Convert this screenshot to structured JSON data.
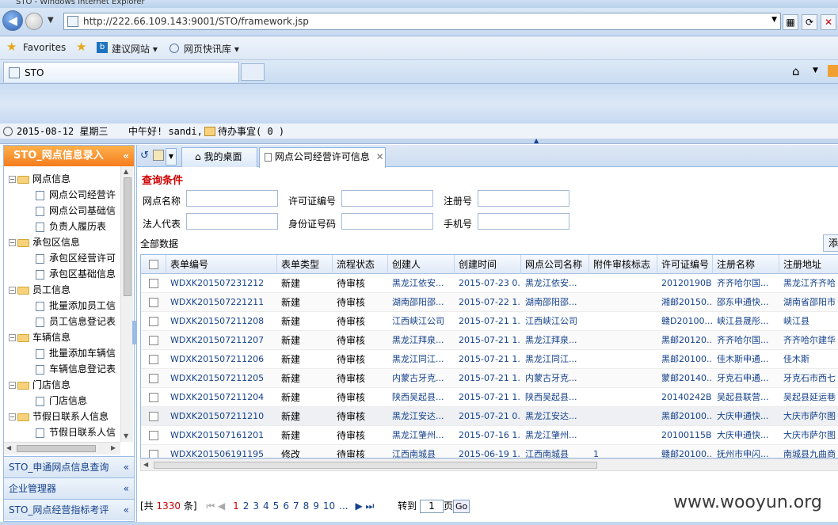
{
  "browser": {
    "window_title": "STO - Windows Internet Explorer",
    "url": "http://222.66.109.143:9001/STO/framework.jsp",
    "favorites_label": "Favorites",
    "fav_items": [
      "建议网站 ▾",
      "网页快讯库 ▾"
    ],
    "tab_title": "STO",
    "icons": [
      "back-arrow",
      "forward-arrow",
      "page",
      "compat-view",
      "refresh",
      "close",
      "star",
      "home"
    ]
  },
  "status": {
    "date": "2015-08-12 星期三",
    "greeting": "中午好! sandi,",
    "todo": "待办事宜( 0 )"
  },
  "left_panel": {
    "header": "STO_网点信息录入",
    "tree": [
      {
        "label": "网点信息",
        "level": 0
      },
      {
        "label": "网点公司经营许",
        "level": 1
      },
      {
        "label": "网点公司基础信",
        "level": 1
      },
      {
        "label": "负责人履历表",
        "level": 1
      },
      {
        "label": "承包区信息",
        "level": 0
      },
      {
        "label": "承包区经营许可",
        "level": 1
      },
      {
        "label": "承包区基础信息",
        "level": 1
      },
      {
        "label": "员工信息",
        "level": 0
      },
      {
        "label": "批量添加员工信",
        "level": 1
      },
      {
        "label": "员工信息登记表",
        "level": 1
      },
      {
        "label": "车辆信息",
        "level": 0
      },
      {
        "label": "批量添加车辆信",
        "level": 1
      },
      {
        "label": "车辆信息登记表",
        "level": 1
      },
      {
        "label": "门店信息",
        "level": 0
      },
      {
        "label": "门店信息",
        "level": 1
      },
      {
        "label": "节假日联系人信息",
        "level": 0
      },
      {
        "label": "节假日联系人信",
        "level": 1
      }
    ],
    "accordions": [
      "STO_申通网点信息查询",
      "企业管理器",
      "STO_网点经营指标考评"
    ]
  },
  "main": {
    "tabs": [
      "我的桌面",
      "网点公司经营许可信息"
    ],
    "query_title": "查询条件",
    "fields": {
      "name": "网点名称",
      "license_no": "许可证编号",
      "reg_no": "注册号",
      "legal_rep": "法人代表",
      "id_no": "身份证号码",
      "phone": "手机号"
    },
    "all_data": "全部数据",
    "add_label": "添",
    "columns": [
      "表单编号",
      "表单类型",
      "流程状态",
      "创建人",
      "创建时间",
      "网点公司名称",
      "附件审核标志",
      "许可证编号",
      "注册名称",
      "注册地址"
    ],
    "rows": [
      [
        "WDXK201507231212",
        "新建",
        "待审核",
        "黑龙江依安...",
        "2015-07-23 0...",
        "黑龙江依安...",
        "",
        "20120190B",
        "齐齐哈尔国...",
        "黑龙江齐齐哈"
      ],
      [
        "WDXK201507221211",
        "新建",
        "待审核",
        "湖南邵阳邵...",
        "2015-07-22 1...",
        "湖南邵阳邵...",
        "",
        "湘邮20150...",
        "邵东申通快...",
        "湖南省邵阳市"
      ],
      [
        "WDXK201507211208",
        "新建",
        "待审核",
        "江西峡江公司",
        "2015-07-21 1...",
        "江西峡江公司",
        "",
        "赣D20100...",
        "峡江县晟彤...",
        "峡江县"
      ],
      [
        "WDXK201507211207",
        "新建",
        "待审核",
        "黑龙江拜泉...",
        "2015-07-21 1...",
        "黑龙江拜泉...",
        "",
        "黑邮20120...",
        "齐齐哈尔国...",
        "齐齐哈尔建华"
      ],
      [
        "WDXK201507211206",
        "新建",
        "待审核",
        "黑龙江同江...",
        "2015-07-21 1...",
        "黑龙江同江...",
        "",
        "黑邮20100...",
        "佳木斯申通...",
        "佳木斯"
      ],
      [
        "WDXK201507211205",
        "新建",
        "待审核",
        "内蒙古牙克...",
        "2015-07-21 1...",
        "内蒙古牙克...",
        "",
        "蒙邮20140...",
        "牙克石申通...",
        "牙克石市西七"
      ],
      [
        "WDXK201507211204",
        "新建",
        "待审核",
        "陕西吴起县...",
        "2015-07-21 1...",
        "陕西吴起县...",
        "",
        "20140242B",
        "吴起县联营...",
        "吴起县延运巷"
      ],
      [
        "WDXK201507211210",
        "新建",
        "待审核",
        "黑龙江安达...",
        "2015-07-21 0...",
        "黑龙江安达...",
        "",
        "黑邮20100...",
        "大庆申通快...",
        "大庆市萨尔图"
      ],
      [
        "WDXK201507161201",
        "新建",
        "待审核",
        "黑龙江肇州...",
        "2015-07-16 1...",
        "黑龙江肇州...",
        "",
        "20100115B",
        "大庆申通快...",
        "大庆市萨尔图"
      ],
      [
        "WDXK201506191195",
        "修改",
        "待审核",
        "江西南城县",
        "2015-06-19 1...",
        "江西南城县",
        "1",
        "赣邮20100...",
        "抚州市申闪...",
        "南城县九曲商"
      ]
    ],
    "pager": {
      "total_prefix": "[共",
      "total": "1330",
      "total_suffix": "条]",
      "first": "⏮",
      "prev": "◀",
      "pages": [
        "1",
        "2",
        "3",
        "4",
        "5",
        "6",
        "7",
        "8",
        "9",
        "10",
        "..."
      ],
      "next": "▶",
      "last": "⏭",
      "goto_label": "转到",
      "goto_value": "1",
      "page_label": "页",
      "go_label": "Go"
    }
  },
  "watermark": "www.wooyun.org"
}
